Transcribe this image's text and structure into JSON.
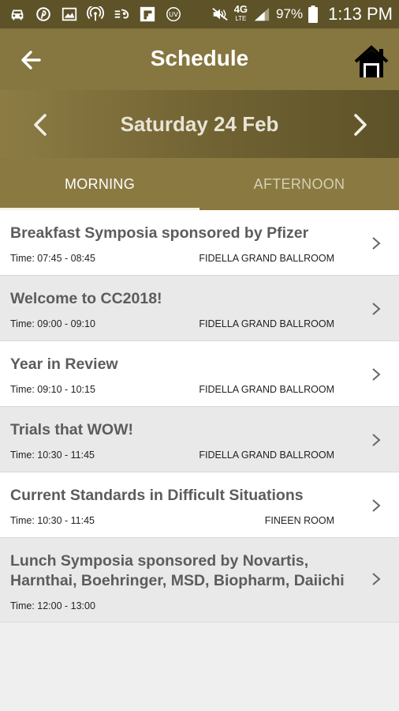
{
  "status_bar": {
    "battery": "97%",
    "time": "1:13 PM",
    "network_top": "4G",
    "network_bottom": "LTE",
    "icons_left": [
      "car-icon",
      "pinterest-icon",
      "image-icon",
      "wireless-icon",
      "voicemail-icon",
      "flipboard-icon",
      "uv-icon"
    ],
    "icons_right": [
      "mute-icon",
      "signal-icon",
      "battery-icon"
    ]
  },
  "app_bar": {
    "title": "Schedule",
    "back_icon": "arrow-left-icon",
    "home_icon": "home-icon"
  },
  "date_bar": {
    "label": "Saturday 24 Feb",
    "prev_icon": "chevron-left-icon",
    "next_icon": "chevron-right-icon"
  },
  "tabs": [
    {
      "label": "MORNING",
      "active": true
    },
    {
      "label": "AFTERNOON",
      "active": false
    }
  ],
  "sessions": [
    {
      "title": "Breakfast Symposia sponsored by Pfizer",
      "time": "Time: 07:45 - 08:45",
      "room": "FIDELLA GRAND BALLROOM"
    },
    {
      "title": "Welcome to CC2018!",
      "time": "Time: 09:00 - 09:10",
      "room": "FIDELLA GRAND BALLROOM"
    },
    {
      "title": "Year in Review",
      "time": "Time: 09:10 - 10:15",
      "room": "FIDELLA GRAND BALLROOM"
    },
    {
      "title": "Trials that WOW!",
      "time": "Time: 10:30 - 11:45",
      "room": "FIDELLA GRAND BALLROOM"
    },
    {
      "title": "Current Standards in Difficult Situations",
      "time": "Time: 10:30 - 11:45",
      "room": "FINEEN ROOM"
    },
    {
      "title": "Lunch Symposia sponsored by Novartis, Harnthai, Boehringer, MSD, Biopharm, Daiichi",
      "time": "Time: 12:00 - 13:00",
      "room": ""
    }
  ],
  "colors": {
    "status_bar": "#5d5228",
    "app_bar": "#86763f",
    "tab_bar": "#8a7a42",
    "row_white": "#ffffff",
    "row_grey": "#e9e9e9",
    "background": "#efefef"
  }
}
